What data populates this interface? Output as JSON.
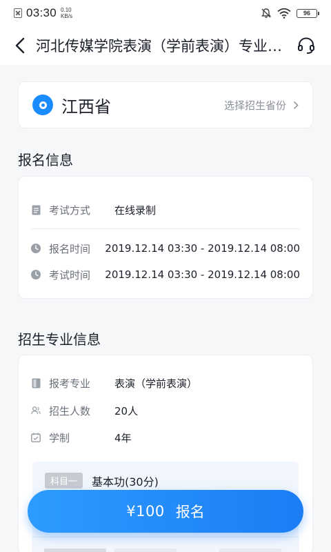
{
  "status_bar": {
    "time": "03:30",
    "speed_value": "0.10",
    "speed_unit": "KB/s",
    "battery": "96"
  },
  "nav": {
    "title": "河北传媒学院表演（学前表演）专业招生信息"
  },
  "province": {
    "name": "江西省",
    "select_label": "选择招生省份"
  },
  "registration": {
    "section_title": "报名信息",
    "rows": [
      {
        "label": "考试方式",
        "value": "在线录制"
      },
      {
        "label": "报名时间",
        "value": "2019.12.14 03:30 - 2019.12.14 08:00"
      },
      {
        "label": "考试时间",
        "value": "2019.12.14 03:30 - 2019.12.14 08:00"
      }
    ]
  },
  "major": {
    "section_title": "招生专业信息",
    "rows": [
      {
        "label": "报考专业",
        "value": "表演（学前表演）"
      },
      {
        "label": "招生人数",
        "value": "20人"
      },
      {
        "label": "学制",
        "value": "4年"
      }
    ],
    "subject": {
      "tag": "科目一",
      "name": "基本功(30分)"
    }
  },
  "signup": {
    "price": "¥100",
    "label": "报名"
  },
  "colors": {
    "accent": "#1a8cff",
    "button_start": "#2d9bff",
    "button_end": "#1b7df5"
  }
}
